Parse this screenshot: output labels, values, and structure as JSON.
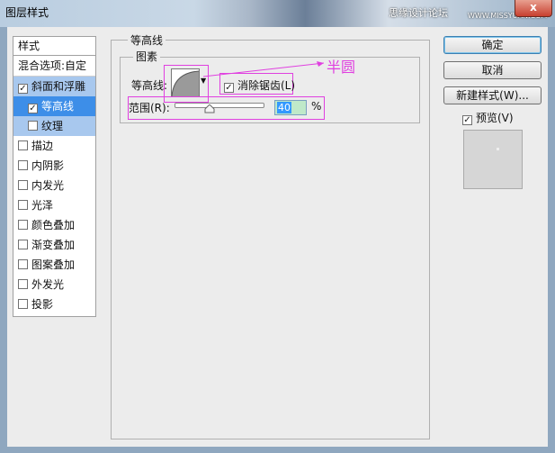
{
  "window": {
    "title": "图层样式",
    "watermark": "思缘设计论坛",
    "watermark_url": "WWW.MISSYUAN.COM",
    "close_label": "x"
  },
  "style_list": {
    "header": "样式",
    "blend_options": "混合选项:自定",
    "items": [
      {
        "label": "斜面和浮雕",
        "checked": true,
        "state": "selected"
      },
      {
        "label": "等高线",
        "checked": true,
        "state": "active",
        "sub": true
      },
      {
        "label": "纹理",
        "checked": false,
        "state": "selected",
        "sub": true
      },
      {
        "label": "描边",
        "checked": false
      },
      {
        "label": "内阴影",
        "checked": false
      },
      {
        "label": "内发光",
        "checked": false
      },
      {
        "label": "光泽",
        "checked": false
      },
      {
        "label": "颜色叠加",
        "checked": false
      },
      {
        "label": "渐变叠加",
        "checked": false
      },
      {
        "label": "图案叠加",
        "checked": false
      },
      {
        "label": "外发光",
        "checked": false
      },
      {
        "label": "投影",
        "checked": false
      }
    ]
  },
  "contour_panel": {
    "group_title": "等高线",
    "subgroup_title": "图素",
    "contour_label": "等高线:",
    "anti_alias_label": "消除锯齿(L)",
    "anti_alias_checked": true,
    "range_label": "范围(R):",
    "range_value": "40",
    "range_unit": "%",
    "range_fraction": 0.4,
    "annotation": "半圆"
  },
  "buttons": {
    "ok": "确定",
    "cancel": "取消",
    "new_style": "新建样式(W)...",
    "preview_label": "预览(V)",
    "preview_checked": true
  },
  "colors": {
    "annotation": "#e040e0",
    "selected_row": "#3d8ee8"
  }
}
